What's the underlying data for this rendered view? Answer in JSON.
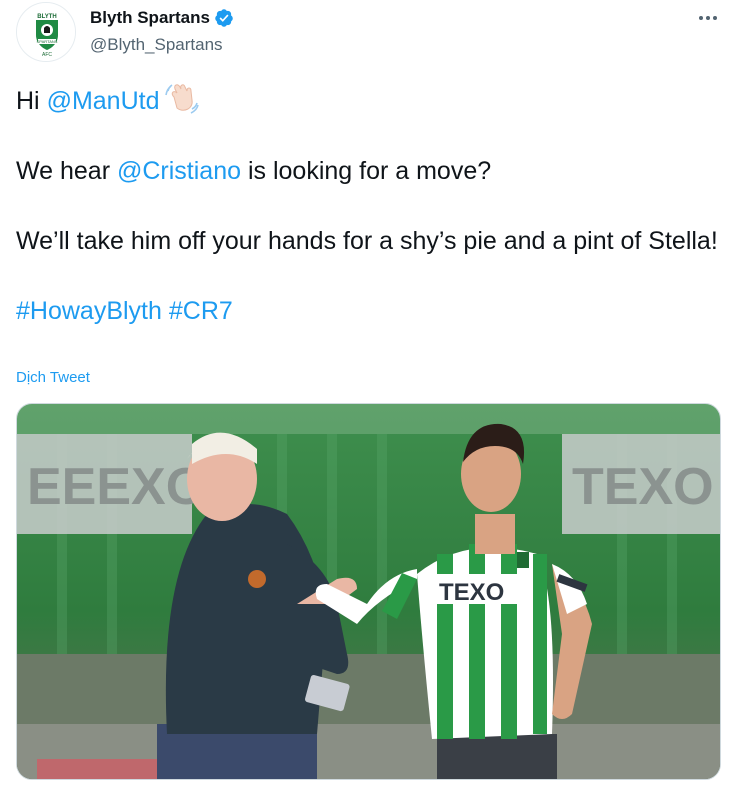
{
  "author": {
    "display_name": "Blyth Spartans",
    "handle": "@Blyth_Spartans",
    "avatar_icon": "club-crest-icon",
    "verified": true
  },
  "menu": {
    "more_icon": "more-options-icon"
  },
  "tweet": {
    "line1_prefix": "Hi ",
    "line1_mention": "@ManUtd",
    "line1_emoji": "waving-hand-emoji",
    "line2_prefix": "We hear ",
    "line2_mention": "@Cristiano",
    "line2_suffix": " is looking for a move?",
    "line3": "We’ll take him off your hands for a shy’s pie and a pint of Stella!",
    "hashtag1": "#HowayBlyth",
    "hashtag2": "#CR7"
  },
  "translate_label": "Dịch Tweet",
  "media": {
    "description_icon": "photo-two-men-handshake",
    "shirt_sponsor": "TEXO",
    "background_banner_left": "EEEXO",
    "background_banner_right": "TEXO"
  },
  "colors": {
    "link": "#1d9bf0",
    "text": "#0f1419",
    "secondary": "#536471",
    "kit_green": "#2a9a47"
  }
}
